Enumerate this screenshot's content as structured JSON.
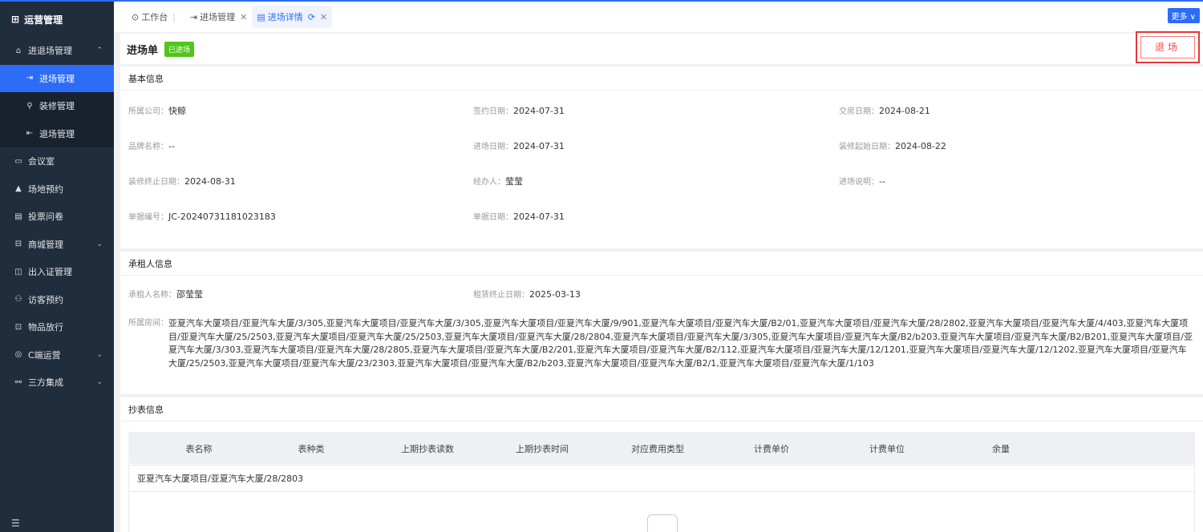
{
  "sidebar": {
    "header": {
      "icon": "⊞",
      "label": "运营管理"
    },
    "items": [
      {
        "icon": "⌂",
        "label": "进退场管理",
        "arrow": "⌃"
      },
      {
        "icon": "⇥",
        "label": "进场管理"
      },
      {
        "icon": "⚲",
        "label": "装修管理"
      },
      {
        "icon": "⇤",
        "label": "退场管理"
      },
      {
        "icon": "▭",
        "label": "会议室"
      },
      {
        "icon": "▲",
        "label": "场地预约"
      },
      {
        "icon": "▤",
        "label": "投票问卷"
      },
      {
        "icon": "⊟",
        "label": "商城管理",
        "arrow": "⌄"
      },
      {
        "icon": "◫",
        "label": "出入证管理"
      },
      {
        "icon": "⚇",
        "label": "访客预约"
      },
      {
        "icon": "⊡",
        "label": "物品放行"
      },
      {
        "icon": "◎",
        "label": "C端运营",
        "arrow": "⌄"
      },
      {
        "icon": "⚯",
        "label": "三方集成",
        "arrow": "⌄"
      }
    ],
    "bottom_icon": "☰"
  },
  "tabs": {
    "items": [
      {
        "icon": "⊙",
        "label": "工作台"
      },
      {
        "icon": "⇥",
        "label": "进场管理",
        "close": "✕"
      },
      {
        "icon": "▤",
        "label": "进场详情",
        "refresh": "⟳",
        "close": "✕"
      }
    ],
    "more": "更多 ∨"
  },
  "header": {
    "title": "进场单",
    "status": "已进场",
    "exit_button": "退场"
  },
  "basic": {
    "title": "基本信息",
    "fields": [
      {
        "label": "所属公司：",
        "value": "快鲸"
      },
      {
        "label": "签约日期：",
        "value": "2024-07-31"
      },
      {
        "label": "交房日期：",
        "value": "2024-08-21"
      },
      {
        "label": "品牌名称：",
        "value": "--"
      },
      {
        "label": "进场日期：",
        "value": "2024-07-31"
      },
      {
        "label": "装修起始日期：",
        "value": "2024-08-22"
      },
      {
        "label": "装修终止日期：",
        "value": "2024-08-31"
      },
      {
        "label": "经办人：",
        "value": "莹莹"
      },
      {
        "label": "进场说明：",
        "value": "--"
      },
      {
        "label": "单据编号：",
        "value": "JC-20240731181023183"
      },
      {
        "label": "单据日期：",
        "value": "2024-07-31"
      }
    ]
  },
  "tenant": {
    "title": "承租人信息",
    "name_label": "承租人名称：",
    "name_value": "邵莹莹",
    "lease_end_label": "租赁终止日期：",
    "lease_end_value": "2025-03-13",
    "rooms_label": "所属房间：",
    "rooms_value": "亚夏汽车大厦项目/亚夏汽车大厦/3/305,亚夏汽车大厦项目/亚夏汽车大厦/3/305,亚夏汽车大厦项目/亚夏汽车大厦/9/901,亚夏汽车大厦项目/亚夏汽车大厦/B2/01,亚夏汽车大厦项目/亚夏汽车大厦/28/2802,亚夏汽车大厦项目/亚夏汽车大厦/4/403,亚夏汽车大厦项目/亚夏汽车大厦/25/2503,亚夏汽车大厦项目/亚夏汽车大厦/25/2503,亚夏汽车大厦项目/亚夏汽车大厦/28/2804,亚夏汽车大厦项目/亚夏汽车大厦/3/305,亚夏汽车大厦项目/亚夏汽车大厦/B2/b203,亚夏汽车大厦项目/亚夏汽车大厦/B2/B201,亚夏汽车大厦项目/亚夏汽车大厦/3/303,亚夏汽车大厦项目/亚夏汽车大厦/28/2805,亚夏汽车大厦项目/亚夏汽车大厦/B2/201,亚夏汽车大厦项目/亚夏汽车大厦/B2/112,亚夏汽车大厦项目/亚夏汽车大厦/12/1201,亚夏汽车大厦项目/亚夏汽车大厦/12/1202,亚夏汽车大厦项目/亚夏汽车大厦/25/2503,亚夏汽车大厦项目/亚夏汽车大厦/23/2303,亚夏汽车大厦项目/亚夏汽车大厦/B2/b203,亚夏汽车大厦项目/亚夏汽车大厦/B2/1,亚夏汽车大厦项目/亚夏汽车大厦/1/103"
  },
  "meter": {
    "title": "抄表信息",
    "columns": [
      "表名称",
      "表种类",
      "上期抄表读数",
      "上期抄表时间",
      "对应费用类型",
      "计费单价",
      "计费单位",
      "余量"
    ],
    "group": "亚夏汽车大厦项目/亚夏汽车大厦/28/2803"
  },
  "colors": {
    "accent": "#2d6cf6",
    "sidebar": "#1f2d3d",
    "status": "#52c41a",
    "danger": "#f04b4b"
  }
}
